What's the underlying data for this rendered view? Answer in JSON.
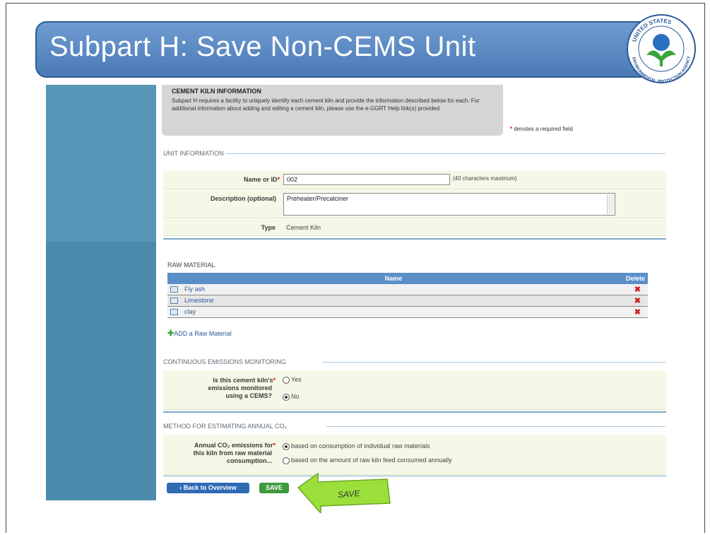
{
  "slide": {
    "title": "Subpart H: Save Non-CEMS Unit",
    "seal_icon": "epa-seal-icon",
    "seal_text": "UNITED STATES ENVIRONMENTAL PROTECTION AGENCY"
  },
  "info": {
    "heading": "CEMENT KILN INFORMATION",
    "text": "Subpart H requires a facility to uniquely identify each cement kiln and provide the information described below for each. For additional information about adding and editing a cement kiln, please use the e-GGRT Help link(s) provided.",
    "required_note": "denotes a required field"
  },
  "unit_information": {
    "heading": "UNIT INFORMATION",
    "name_label": "Name or ID",
    "name_value": "002",
    "name_hint": "(40 characters maximum)",
    "description_label": "Description (optional)",
    "description_value": "Preheater/Precalciner",
    "type_label": "Type",
    "type_value": "Cement Kiln"
  },
  "raw_material": {
    "heading": "RAW MATERIAL",
    "col_name": "Name",
    "col_delete": "Delete",
    "rows": [
      "Fly ash",
      "Limestone",
      "clay"
    ],
    "add_label": "ADD a Raw Material"
  },
  "cems": {
    "heading": "CONTINUOUS EMISSIONS MONITORING",
    "question": "Is this cement kiln's emissions monitored using a CEMS?",
    "q1": "Is this cement kiln's",
    "q2": "emissions monitored",
    "q3": "using a CEMS?",
    "options": [
      "Yes",
      "No"
    ],
    "selected": "No"
  },
  "method": {
    "heading": "METHOD FOR ESTIMATING ANNUAL CO₂",
    "q1": "Annual CO₂ emissions for",
    "q2": "this kiln from raw material",
    "q3": "consumption...",
    "options": [
      "based on consumption of individual raw materials",
      "based on the amount of raw kiln feed consumed annually"
    ],
    "selected": "based on consumption of individual raw materials"
  },
  "buttons": {
    "back": "‹ Back to Overview",
    "save": "SAVE",
    "callout": "SAVE"
  },
  "colors": {
    "title_bar": "#5b8bc5",
    "sidebar": "#4b8aaa",
    "table_header": "#5c8fc8",
    "save_button": "#3d9a3d",
    "arrow": "#9be03a"
  }
}
